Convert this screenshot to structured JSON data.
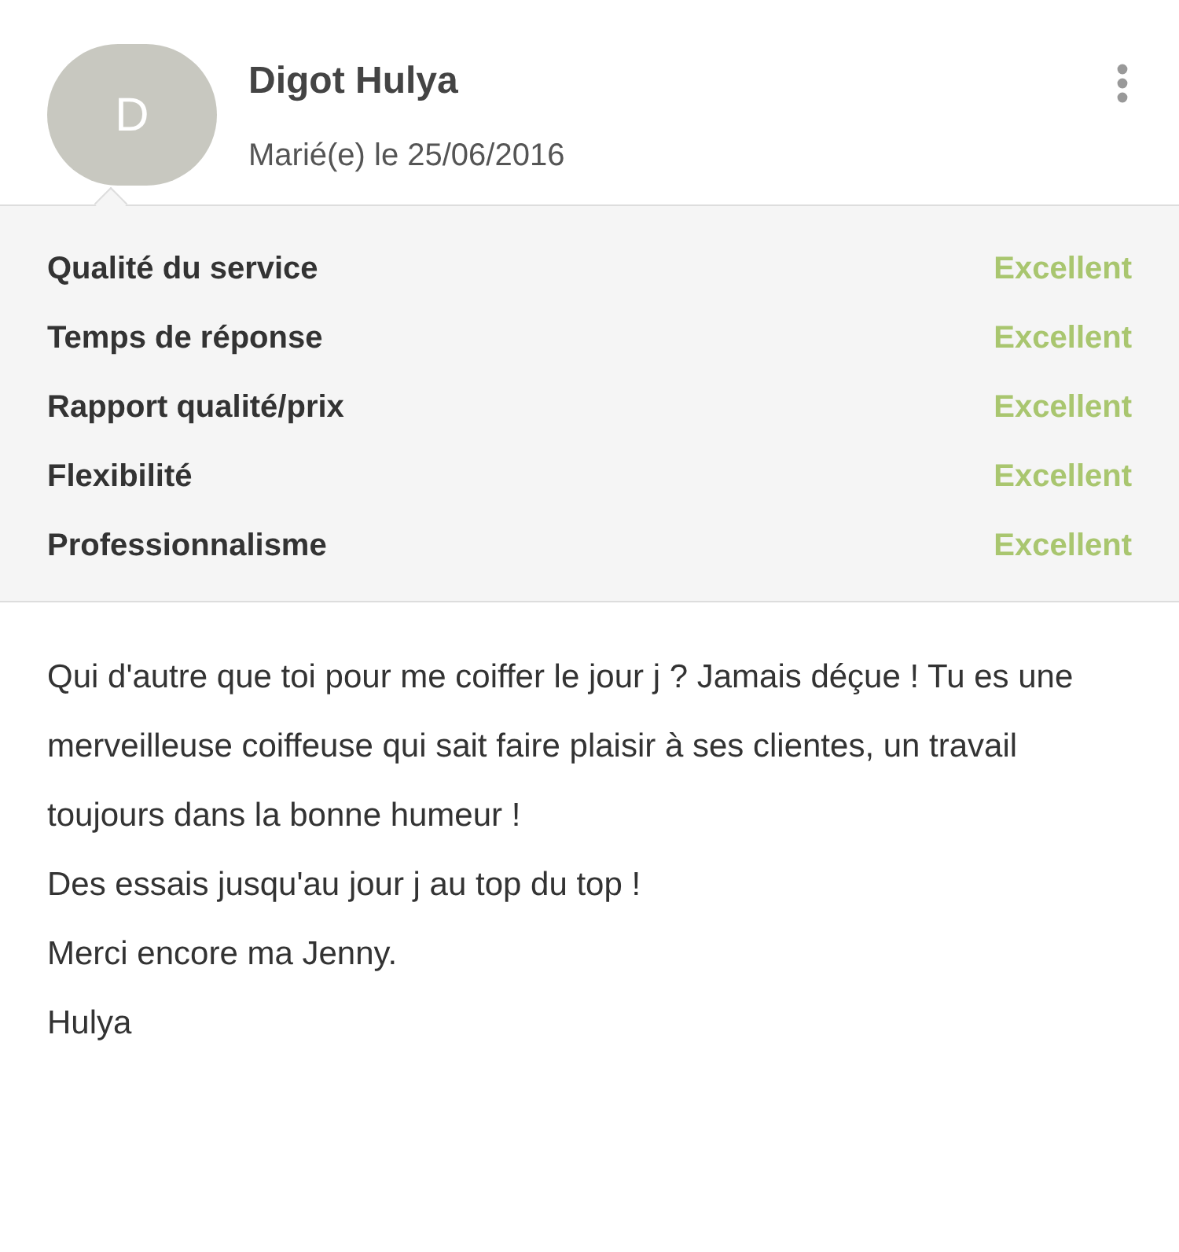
{
  "reviewer": {
    "initial": "D",
    "name": "Digot Hulya",
    "subtitle": "Marié(e) le 25/06/2016"
  },
  "ratings": [
    {
      "label": "Qualité du service",
      "value": "Excellent"
    },
    {
      "label": "Temps de réponse",
      "value": "Excellent"
    },
    {
      "label": "Rapport qualité/prix",
      "value": "Excellent"
    },
    {
      "label": "Flexibilité",
      "value": "Excellent"
    },
    {
      "label": "Professionnalisme",
      "value": "Excellent"
    }
  ],
  "review": [
    "Qui d'autre que toi pour me coiffer le jour j ? Jamais déçue ! Tu es une merveilleuse coiffeuse qui sait faire plaisir à ses clientes, un travail toujours dans la bonne humeur !",
    "Des essais jusqu'au jour j au top du top !",
    "Merci encore ma Jenny.",
    "Hulya"
  ]
}
